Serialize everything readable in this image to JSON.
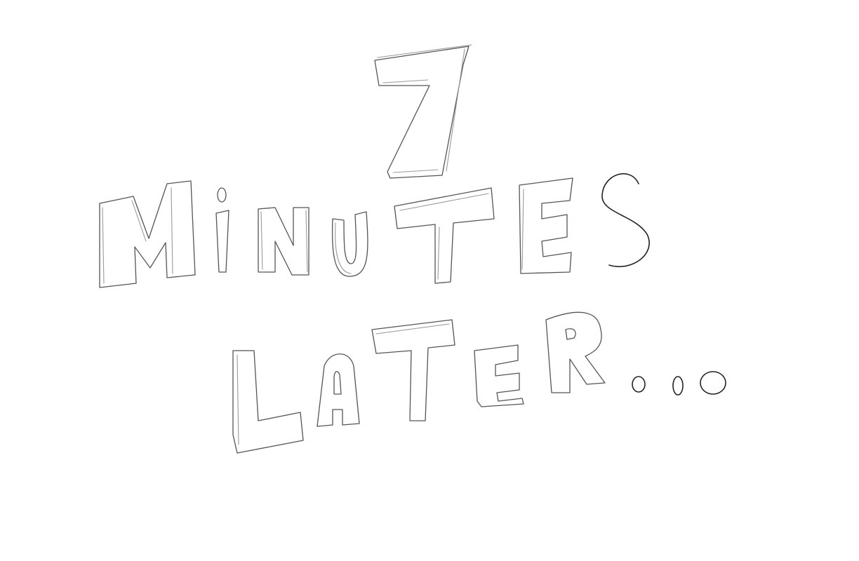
{
  "sketch": {
    "number": "7",
    "word_1": "MINUTES",
    "word_2": "LATER",
    "ellipsis": "..."
  },
  "colors": {
    "background": "#ffffff",
    "ink": "#555555",
    "ink_dark": "#222222",
    "ink_light": "#9a9a9a"
  }
}
